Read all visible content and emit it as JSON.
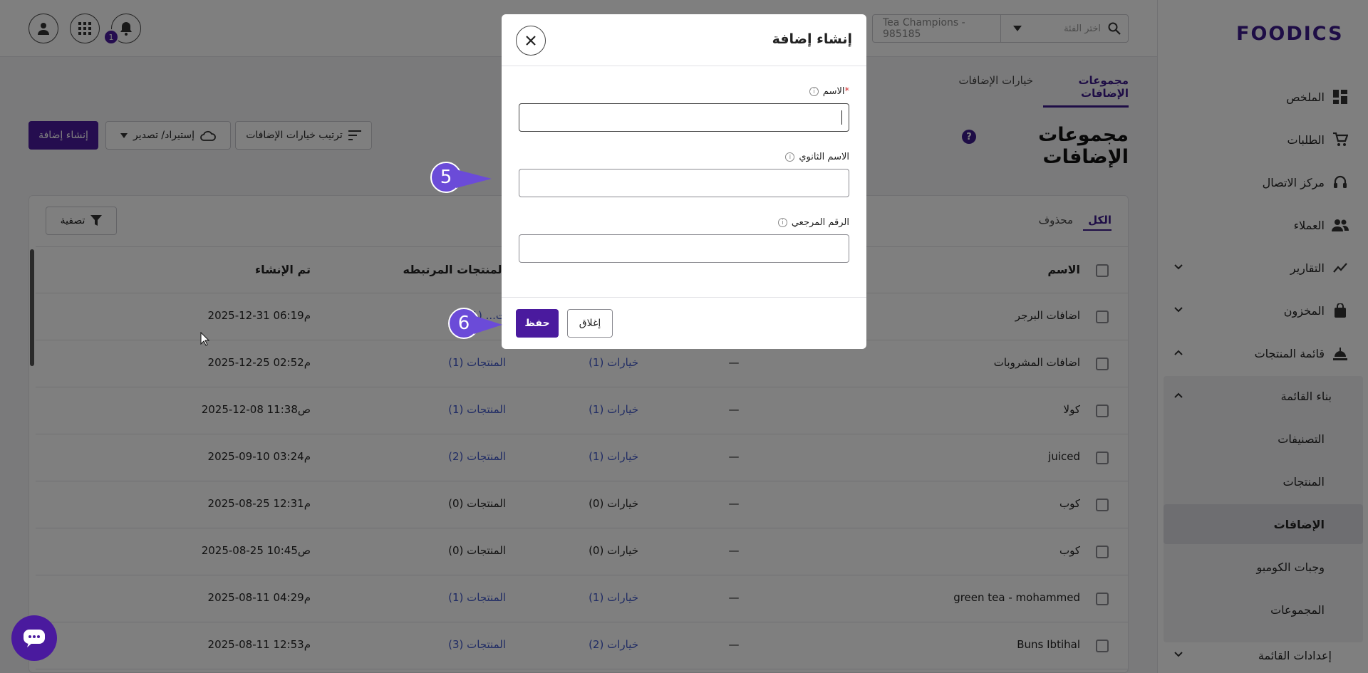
{
  "app": {
    "logo": "FOODICS"
  },
  "topbar": {
    "branch": "Tea Champions - 985185",
    "search_placeholder": "اختر الفئة",
    "notification_count": "1"
  },
  "sidebar": {
    "items": [
      {
        "label": "الملخص",
        "icon": "dashboard-icon"
      },
      {
        "label": "الطلبات",
        "icon": "cart-icon"
      },
      {
        "label": "مركز الاتصال",
        "icon": "headset-icon"
      },
      {
        "label": "العملاء",
        "icon": "people-icon"
      },
      {
        "label": "التقارير",
        "icon": "chart-line-icon"
      },
      {
        "label": "المخزون",
        "icon": "bag-icon"
      },
      {
        "label": "قائمة المنتجات",
        "icon": "food-icon"
      }
    ],
    "menu_builder": "بناء القائمة",
    "sub_items": [
      "التصنيفات",
      "المنتجات",
      "الإضافات",
      "وجبات الكومبو",
      "المجموعات"
    ],
    "menu_settings": "إعدادات القائمة"
  },
  "page": {
    "tab_groups": "مجموعات الإضافات",
    "tab_options": "خيارات الإضافات",
    "title": "مجموعات الإضافات",
    "create_button": "إنشاء إضافة",
    "import_export": "إستيراد/ تصدير",
    "sort_options": "ترتيب خيارات الإضافات"
  },
  "table": {
    "filter_all": "الكل",
    "filter_deleted": "محذوف",
    "filter_button": "تصفية",
    "columns": {
      "name": "الاسم",
      "linked_products": "المنتجات المرتبطه",
      "created": "تم الإنشاء"
    },
    "rows": [
      {
        "name": "اضافات البرجر",
        "secondary": "",
        "options": "",
        "products": "(1) ...ت",
        "created": "2025-12-31 06:19م",
        "linked": true
      },
      {
        "name": "اضافات المشروبات",
        "secondary": "—",
        "options": "خيارات (1)",
        "products": "المنتجات (1)",
        "created": "2025-12-25 02:52م",
        "linked": true
      },
      {
        "name": "كولا",
        "secondary": "—",
        "options": "خيارات (1)",
        "products": "المنتجات (1)",
        "created": "2025-12-08 11:38ص",
        "linked": true
      },
      {
        "name": "juiced",
        "secondary": "—",
        "options": "خيارات (1)",
        "products": "المنتجات (2)",
        "created": "2025-09-10 03:24م",
        "linked": true
      },
      {
        "name": "كوب",
        "secondary": "—",
        "options": "خيارات (0)",
        "products": "المنتجات (0)",
        "created": "2025-08-25 12:31م",
        "linked": false
      },
      {
        "name": "كوب",
        "secondary": "—",
        "options": "خيارات (0)",
        "products": "المنتجات (0)",
        "created": "2025-08-25 10:45ص",
        "linked": false
      },
      {
        "name": "green tea - mohammed",
        "secondary": "—",
        "options": "خيارات (1)",
        "products": "المنتجات (1)",
        "created": "2025-08-11 04:29م",
        "linked": true
      },
      {
        "name": "Buns Ibtihal",
        "secondary": "—",
        "options": "خيارات (2)",
        "products": "المنتجات (3)",
        "created": "2025-08-11 12:53م",
        "linked": true
      }
    ]
  },
  "modal": {
    "title": "إنشاء إضافة",
    "name_label": "الاسم",
    "required_mark": "*",
    "secondary_label": "الاسم الثانوي",
    "reference_label": "الرقم المرجعي",
    "name_value": "",
    "save_button": "حفظ",
    "close_button": "إغلاق"
  },
  "annotations": {
    "step5": "5",
    "step6": "6"
  },
  "colors": {
    "brand": "#4a1a9e",
    "link": "#3f56c9",
    "marker": "#6b4bd8"
  }
}
